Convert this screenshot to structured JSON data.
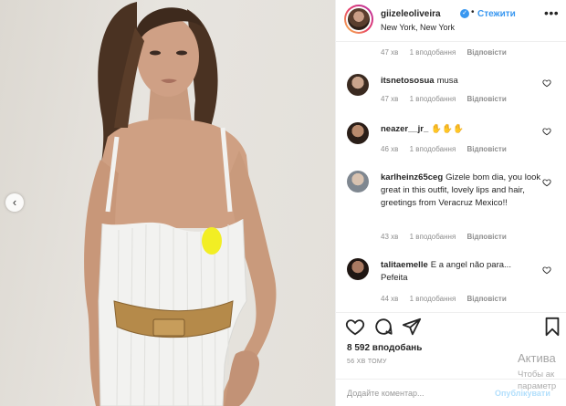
{
  "header": {
    "username": "giizeleoliveira",
    "follow_label": "Стежити",
    "location": "New York, New York",
    "separator": "•",
    "more_glyph": "•••"
  },
  "top_meta": {
    "time": "47 хв",
    "likes": "1 вподобання",
    "reply": "Відповісти"
  },
  "comments": [
    {
      "user": "itsnetososua",
      "text": "musa",
      "time": "47 хв",
      "likes": "1 вподобання",
      "reply": "Відповісти"
    },
    {
      "user": "neazer__jr_",
      "text": "✋✋✋",
      "time": "46 хв",
      "likes": "1 вподобання",
      "reply": "Відповісти"
    },
    {
      "user": "karlheinz65ceg",
      "text": "Gizele bom dia, you look great in this outfit, lovely lips and hair, greetings from Veracruz Mexico!!",
      "time": "43 хв",
      "likes": "1 вподобання",
      "reply": "Відповісти"
    },
    {
      "user": "talitaemelle",
      "text": "E a angel não para... Pefeita",
      "time": "44 хв",
      "likes": "1 вподобання",
      "reply": "Відповісти"
    }
  ],
  "actions": {
    "likes_count": "8 592 вподобань",
    "timestamp": "56 ХВ ТОМУ"
  },
  "comment_box": {
    "placeholder": "Додайте коментар...",
    "publish_label": "Опублікувати"
  },
  "windows_watermark": {
    "title": "Актива",
    "subtitle": "Чтобы ак параметр"
  },
  "colors": {
    "accent_blue": "#3897f0",
    "publish_disabled": "#b2dffc",
    "meta_gray": "#8e8e8e",
    "text": "#262626"
  },
  "icons": [
    "verified-badge-icon",
    "more-options-icon",
    "chevron-left-icon",
    "heart-icon",
    "comment-icon",
    "share-icon",
    "bookmark-icon",
    "emoji-icon"
  ]
}
